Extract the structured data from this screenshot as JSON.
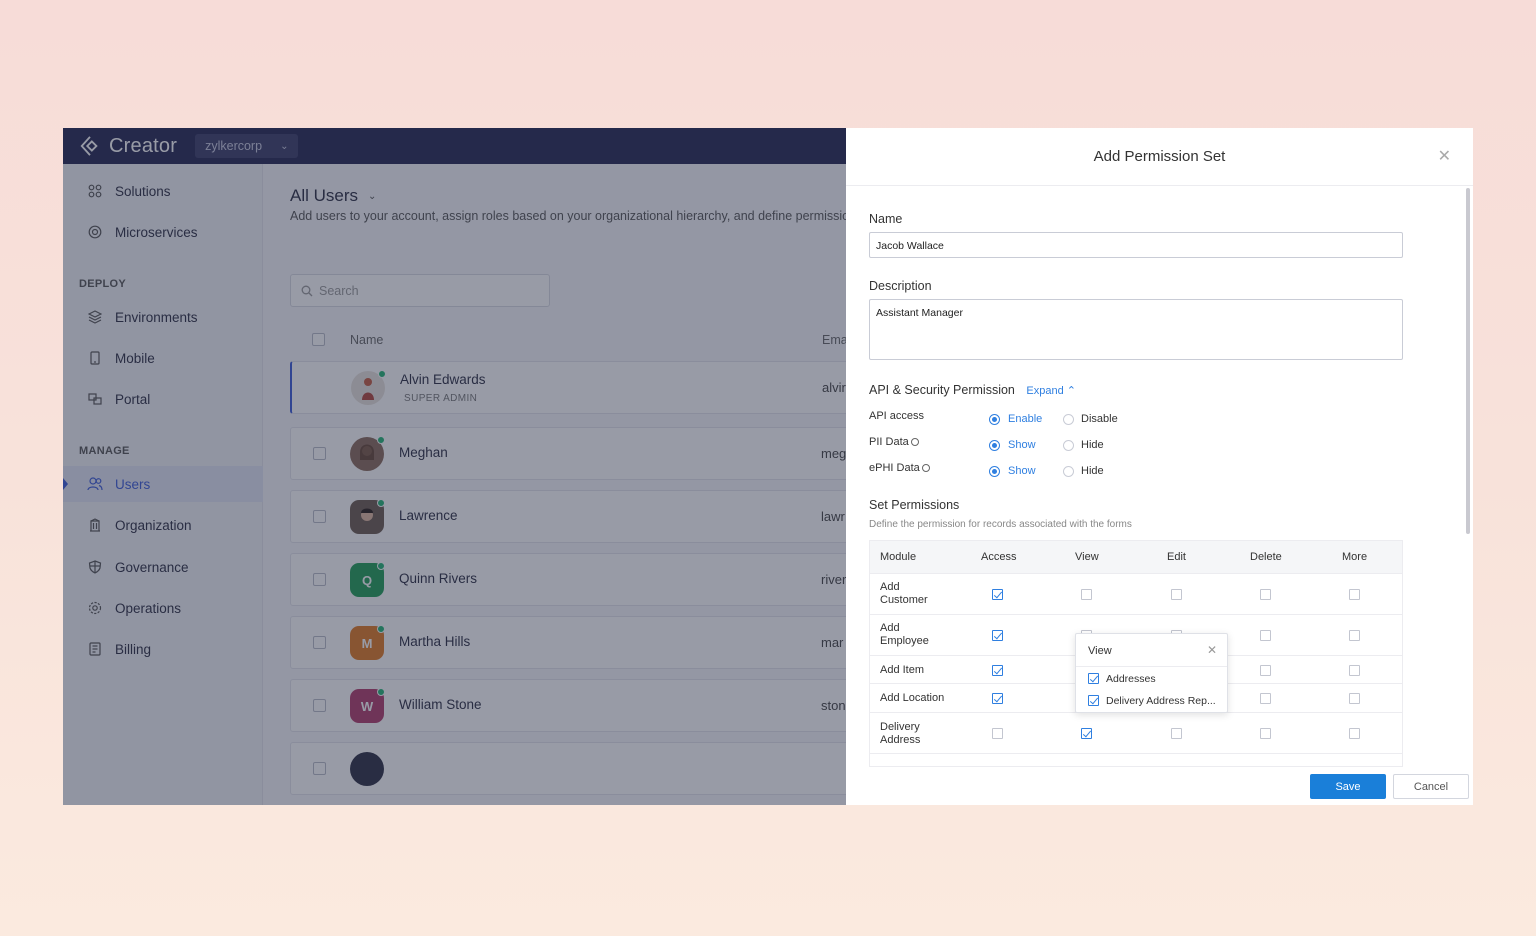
{
  "app": {
    "brand": "Creator",
    "org": "zylkercorp"
  },
  "sidebar": {
    "items_top": [
      {
        "label": "Solutions",
        "icon": "grid-icon"
      },
      {
        "label": "Microservices",
        "icon": "microservices-icon"
      }
    ],
    "section_deploy": "DEPLOY",
    "items_deploy": [
      {
        "label": "Environments",
        "icon": "layers-icon"
      },
      {
        "label": "Mobile",
        "icon": "mobile-icon"
      },
      {
        "label": "Portal",
        "icon": "portal-icon"
      }
    ],
    "section_manage": "MANAGE",
    "items_manage": [
      {
        "label": "Users",
        "icon": "users-icon",
        "active": true
      },
      {
        "label": "Organization",
        "icon": "organization-icon"
      },
      {
        "label": "Governance",
        "icon": "shield-icon"
      },
      {
        "label": "Operations",
        "icon": "gear-icon"
      },
      {
        "label": "Billing",
        "icon": "billing-icon"
      }
    ]
  },
  "main": {
    "title": "All Users",
    "description": "Add users to your account, assign roles based on your organizational hierarchy, and define permission",
    "search_placeholder": "Search",
    "columns": [
      "Name",
      "Ema"
    ],
    "users": [
      {
        "name": "Alvin Edwards",
        "role": "SUPER ADMIN",
        "email": "alvir",
        "initial": "",
        "color": "#e9e3dc"
      },
      {
        "name": "Meghan",
        "role": "",
        "email": "meg",
        "initial": "",
        "color": "#8a6a5a"
      },
      {
        "name": "Lawrence",
        "role": "",
        "email": "lawr",
        "initial": "",
        "color": "#6b5a50"
      },
      {
        "name": "Quinn Rivers",
        "role": "",
        "email": "river",
        "initial": "Q",
        "color": "#1f9d55"
      },
      {
        "name": "Martha Hills",
        "role": "",
        "email": "mar",
        "initial": "M",
        "color": "#e07a22"
      },
      {
        "name": "William Stone",
        "role": "",
        "email": "ston",
        "initial": "W",
        "color": "#b03a6a"
      }
    ]
  },
  "modal": {
    "title": "Add Permission Set",
    "name_label": "Name",
    "name_value": "Jacob Wallace",
    "description_label": "Description",
    "description_value": "Assistant Manager",
    "api_section_title": "API & Security Permission",
    "expand_label": "Expand",
    "api_rows": [
      {
        "label": "API access",
        "option_on": "Enable",
        "option_off": "Disable",
        "info": false
      },
      {
        "label": "PII Data",
        "option_on": "Show",
        "option_off": "Hide",
        "info": true
      },
      {
        "label": "ePHI Data",
        "option_on": "Show",
        "option_off": "Hide",
        "info": true
      }
    ],
    "set_permissions_title": "Set Permissions",
    "set_permissions_desc": "Define the permission for records associated with the forms",
    "table_headers": [
      "Module",
      "Access",
      "View",
      "Edit",
      "Delete",
      "More"
    ],
    "modules": [
      {
        "name": "Add Customer",
        "access": true,
        "view": false,
        "edit": false,
        "delete": false,
        "more": false
      },
      {
        "name": "Add Employee",
        "access": true,
        "view": false,
        "edit": false,
        "delete": false,
        "more": false
      },
      {
        "name": "Add Item",
        "access": true,
        "view": false,
        "edit": false,
        "delete": false,
        "more": false
      },
      {
        "name": "Add Location",
        "access": true,
        "view": false,
        "edit": false,
        "delete": false,
        "more": false
      },
      {
        "name": "Delivery Address",
        "access": false,
        "view": true,
        "edit": false,
        "delete": false,
        "more": false
      }
    ],
    "popover": {
      "title": "View",
      "items": [
        "Addresses",
        "Delivery Address Rep..."
      ]
    },
    "save_label": "Save",
    "cancel_label": "Cancel"
  },
  "colors": {
    "accent": "#2f7fe0",
    "topbar": "#232552",
    "save_button": "#1a7fd9"
  }
}
